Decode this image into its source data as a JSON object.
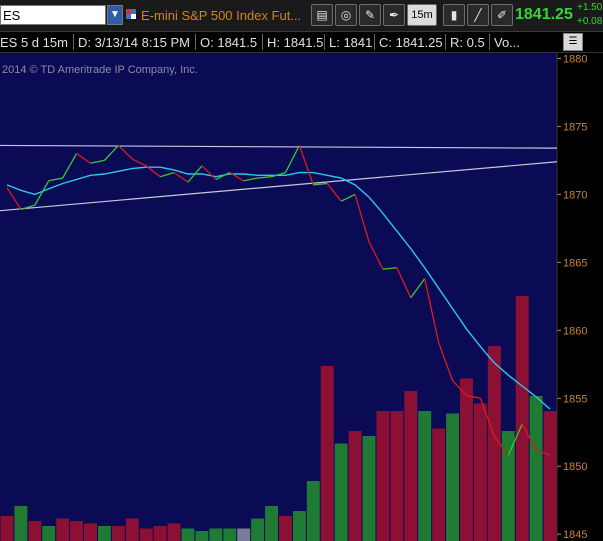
{
  "toolbar": {
    "symbol": "ES",
    "instrument_title": "E-mini S&P 500 Index Fut...",
    "interval_button": "15m",
    "last_price": "1841.25",
    "change": "+1.50",
    "change_pct": "+0.08"
  },
  "info": {
    "symbol_period": "ES 5 d 15m",
    "date": "D: 3/13/14 8:15 PM",
    "open": "O: 1841.5",
    "high": "H: 1841.5",
    "low": "L: 1841",
    "close": "C: 1841.25",
    "range": "R: 0.5",
    "volume": "Vo..."
  },
  "copyright": "2014 © TD Ameritrade IP Company, Inc.",
  "colors": {
    "plot_bg": "#0b0b55",
    "down": "#8c1033",
    "up": "#1f7a34",
    "neutral": "#7a7a99",
    "price_down": "#dd1b1b",
    "price_up": "#35c935",
    "ma": "#2ec6ec",
    "trendline": "#c8c8d8",
    "axis_text": "#c8823a"
  },
  "chart_data": {
    "type": "line",
    "y_axis": {
      "min": 1844.5,
      "max": 1880.4,
      "ticks": [
        1880,
        1875,
        1870,
        1865,
        1860,
        1855,
        1850,
        1845
      ],
      "position": "right"
    },
    "price": [
      1870.5,
      1868.9,
      1869.2,
      1871.0,
      1871.2,
      1873.0,
      1872.3,
      1872.5,
      1873.6,
      1872.6,
      1872.1,
      1871.3,
      1871.6,
      1870.9,
      1872.1,
      1871.1,
      1871.6,
      1871.0,
      1871.2,
      1871.3,
      1871.6,
      1873.6,
      1870.7,
      1870.8,
      1869.5,
      1870.0,
      1866.5,
      1864.5,
      1864.6,
      1862.4,
      1863.8,
      1859.1,
      1856.3,
      1855.2,
      1855.0,
      1852.2,
      1850.8,
      1853.1,
      1851.2,
      1850.8
    ],
    "moving_average": [
      1870.7,
      1870.3,
      1870.0,
      1870.4,
      1870.8,
      1871.1,
      1871.4,
      1871.5,
      1871.7,
      1871.9,
      1872.0,
      1872.0,
      1871.8,
      1871.5,
      1871.5,
      1871.3,
      1871.5,
      1871.5,
      1871.4,
      1871.4,
      1871.4,
      1871.6,
      1871.6,
      1871.4,
      1871.2,
      1870.7,
      1869.8,
      1868.6,
      1867.3,
      1866.0,
      1864.6,
      1863.1,
      1861.6,
      1860.1,
      1858.8,
      1857.6,
      1856.7,
      1855.9,
      1855.1,
      1854.2
    ],
    "direction": [
      "d",
      "d",
      "u",
      "u",
      "u",
      "u",
      "d",
      "u",
      "u",
      "d",
      "d",
      "d",
      "u",
      "d",
      "u",
      "d",
      "u",
      "d",
      "u",
      "u",
      "u",
      "u",
      "d",
      "u",
      "d",
      "u",
      "d",
      "d",
      "u",
      "d",
      "u",
      "d",
      "d",
      "d",
      "d",
      "d",
      "d",
      "u",
      "d",
      "d"
    ],
    "volume": [
      10,
      14,
      8,
      6,
      9,
      8,
      7,
      6,
      6,
      9,
      5,
      6,
      7,
      5,
      4,
      5,
      5,
      5,
      9,
      14,
      10,
      12,
      24,
      70,
      39,
      44,
      42,
      52,
      52,
      60,
      52,
      45,
      51,
      65,
      55,
      78,
      44,
      98,
      58,
      52
    ],
    "volume_direction": [
      "d",
      "u",
      "d",
      "u",
      "d",
      "d",
      "d",
      "u",
      "d",
      "d",
      "d",
      "d",
      "d",
      "u",
      "u",
      "u",
      "u",
      "n",
      "u",
      "u",
      "d",
      "u",
      "u",
      "d",
      "u",
      "d",
      "u",
      "d",
      "d",
      "d",
      "u",
      "d",
      "u",
      "d",
      "d",
      "d",
      "u",
      "d",
      "u",
      "d"
    ],
    "trendlines": [
      {
        "from": [
          0,
          1873.6
        ],
        "to": [
          40,
          1873.4
        ]
      },
      {
        "from": [
          0,
          1868.8
        ],
        "to": [
          40,
          1872.4
        ]
      }
    ]
  }
}
